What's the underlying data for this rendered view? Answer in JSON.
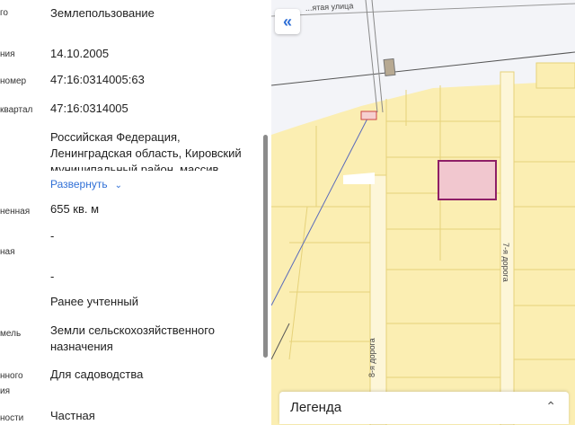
{
  "panel": {
    "rows": [
      {
        "label": "го",
        "value": "Землепользование"
      },
      {
        "label": "ния",
        "value": "14.10.2005"
      },
      {
        "label": "номер",
        "value": "47:16:0314005:63"
      },
      {
        "label": "квартал",
        "value": "47:16:0314005"
      },
      {
        "label": "",
        "value": "Российская Федерация, Ленинградская область, Кировский муниципальный район, массив"
      },
      {
        "label": "ненная",
        "value": "655 кв. м"
      },
      {
        "label": "",
        "value": "-"
      },
      {
        "label": "ная",
        "value": ""
      },
      {
        "label": "",
        "value": "-"
      },
      {
        "label": "",
        "value": "Ранее учтенный"
      },
      {
        "label": "мель",
        "value": "Земли сельскохозяйственного назначения"
      },
      {
        "label": "нного",
        "value": "Для садоводства"
      },
      {
        "label": "ия",
        "value": ""
      },
      {
        "label": "ности",
        "value": "Частная"
      }
    ],
    "expand_label": "Развернуть",
    "expand_icon": "chevron-down-icon"
  },
  "map": {
    "collapse_icon": "double-chevron-left-icon",
    "roads": [
      "7-я дорога",
      "8-я дорога",
      "...ятая улица"
    ],
    "parcel_fill": "#fbeeb2",
    "parcel_stroke": "#e6d27a",
    "selected_fill": "#f1c7cf",
    "selected_stroke": "#8e1f66"
  },
  "legend": {
    "title": "Легенда",
    "toggle_icon": "chevron-up-icon"
  }
}
